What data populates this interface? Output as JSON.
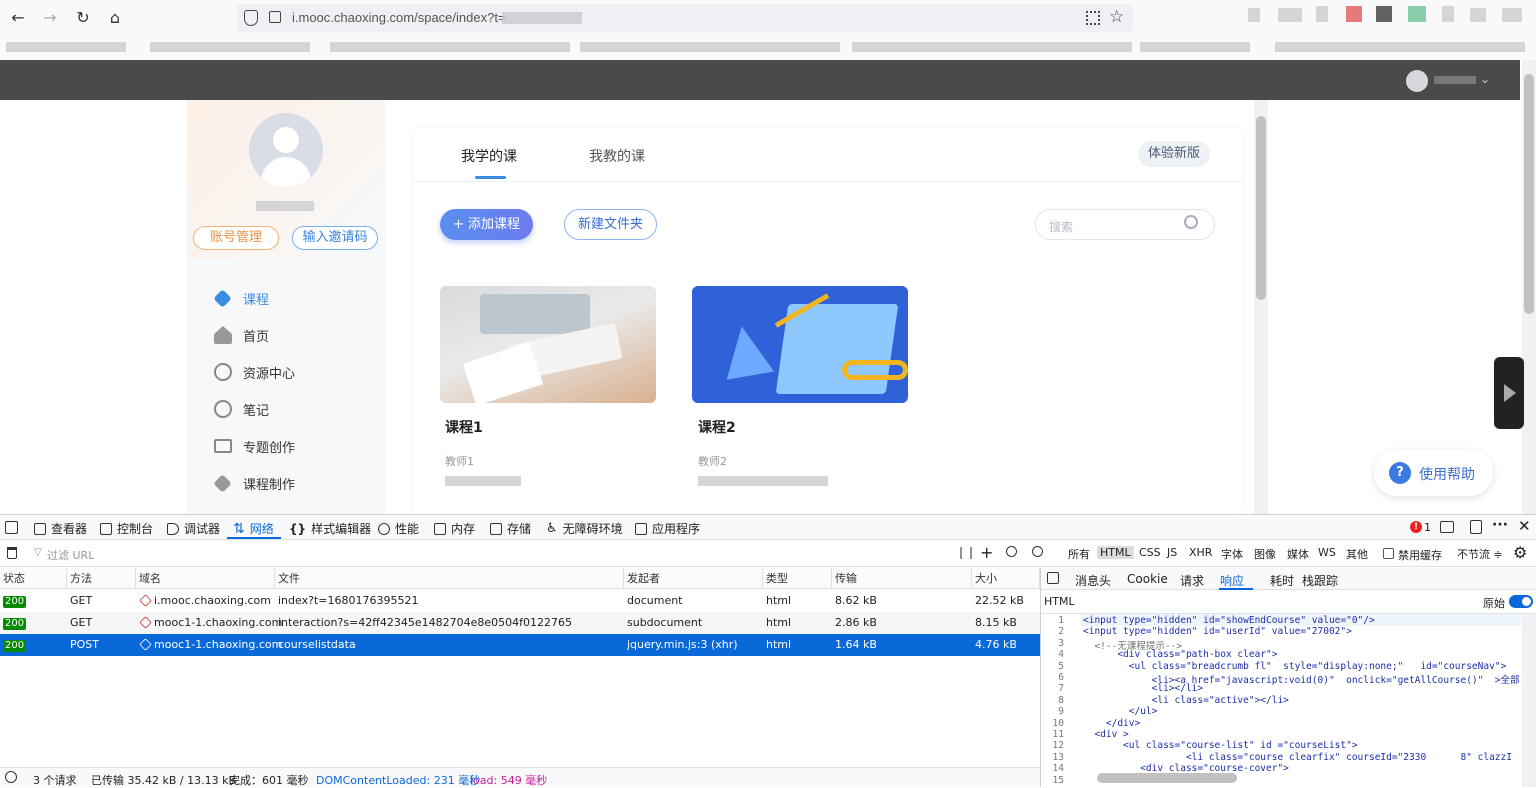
{
  "browser": {
    "url": "i.mooc.chaoxing.com/space/index?t=",
    "back": "←",
    "forward": "→",
    "reload": "↻",
    "home": "⌂"
  },
  "site": {
    "user_name_blurred": "",
    "nav": [
      {
        "label": "课程",
        "active": true
      },
      {
        "label": "首页"
      },
      {
        "label": "资源中心"
      },
      {
        "label": "笔记"
      },
      {
        "label": "专题创作"
      },
      {
        "label": "课程制作"
      }
    ],
    "account_btn": "账号管理",
    "invite_btn": "输入邀请码",
    "tabs": [
      "我学的课",
      "我教的课"
    ],
    "try_new": "体验新版",
    "add_course": "+ 添加课程",
    "new_folder": "新建文件夹",
    "search_placeholder": "搜索",
    "courses": [
      {
        "title": "课程1",
        "teacher": "教师1"
      },
      {
        "title": "课程2",
        "teacher": "教师2"
      }
    ],
    "help": "使用帮助"
  },
  "devtools": {
    "tabs": [
      "查看器",
      "控制台",
      "调试器",
      "网络",
      "样式编辑器",
      "性能",
      "内存",
      "存储",
      "无障碍环境",
      "应用程序"
    ],
    "error_count": "1",
    "filter_placeholder": "过滤 URL",
    "type_filters": [
      "所有",
      "HTML",
      "CSS",
      "JS",
      "XHR",
      "字体",
      "图像",
      "媒体",
      "WS",
      "其他"
    ],
    "disable_cache": "禁用缓存",
    "throttle": "不节流 ≑",
    "columns": [
      "状态",
      "方法",
      "域名",
      "文件",
      "发起者",
      "类型",
      "传输",
      "大小"
    ],
    "requests": [
      {
        "status": "200",
        "method": "GET",
        "domain": "i.mooc.chaoxing.com",
        "file": "index?t=1680176395521",
        "initiator": "document",
        "type": "html",
        "transfer": "8.62 kB",
        "size": "22.52 kB"
      },
      {
        "status": "200",
        "method": "GET",
        "domain": "mooc1-1.chaoxing.com",
        "file": "interaction?s=42ff42345e1482704e8e0504f0122765",
        "initiator": "subdocument",
        "type": "html",
        "transfer": "2.86 kB",
        "size": "8.15 kB"
      },
      {
        "status": "200",
        "method": "POST",
        "domain": "mooc1-1.chaoxing.com",
        "file": "courselistdata",
        "initiator": "jquery.min.js:3 (xhr)",
        "type": "html",
        "transfer": "1.64 kB",
        "size": "4.76 kB",
        "selected": true
      }
    ],
    "detail_tabs": [
      "消息头",
      "Cookie",
      "请求",
      "响应",
      "耗时",
      "栈跟踪"
    ],
    "detail_active": "响应",
    "html_label": "HTML",
    "raw_label": "原始",
    "code_lines": [
      "<input type=\"hidden\" id=\"showEndCourse\" value=\"0\"/>",
      "<input type=\"hidden\" id=\"userId\" value=\"27002\">",
      "  <!--无课程提示-->",
      "      <div class=\"path-box clear\">",
      "        <ul class=\"breadcrumb fl\"  style=\"display:none;\"   id=\"courseNav\">",
      "            <li><a href=\"javascript:void(0)\"  onclick=\"getAllCourse()\"  >全部i",
      "            <li></li>",
      "            <li class=\"active\"></li>",
      "        </ul>",
      "    </div>",
      "  <div >",
      "       <ul class=\"course-list\" id =\"courseList\">",
      "                  <li class=\"course clearfix\" courseId=\"2330      8\" clazzI",
      "          <div class=\"course-cover\">",
      ""
    ],
    "status": {
      "requests": "3 个请求",
      "transferred": "已传输 35.42 kB / 13.13 kB",
      "finish": "完成：601 毫秒",
      "dcl": "DOMContentLoaded: 231 毫秒",
      "load": "load: 549 毫秒"
    }
  }
}
